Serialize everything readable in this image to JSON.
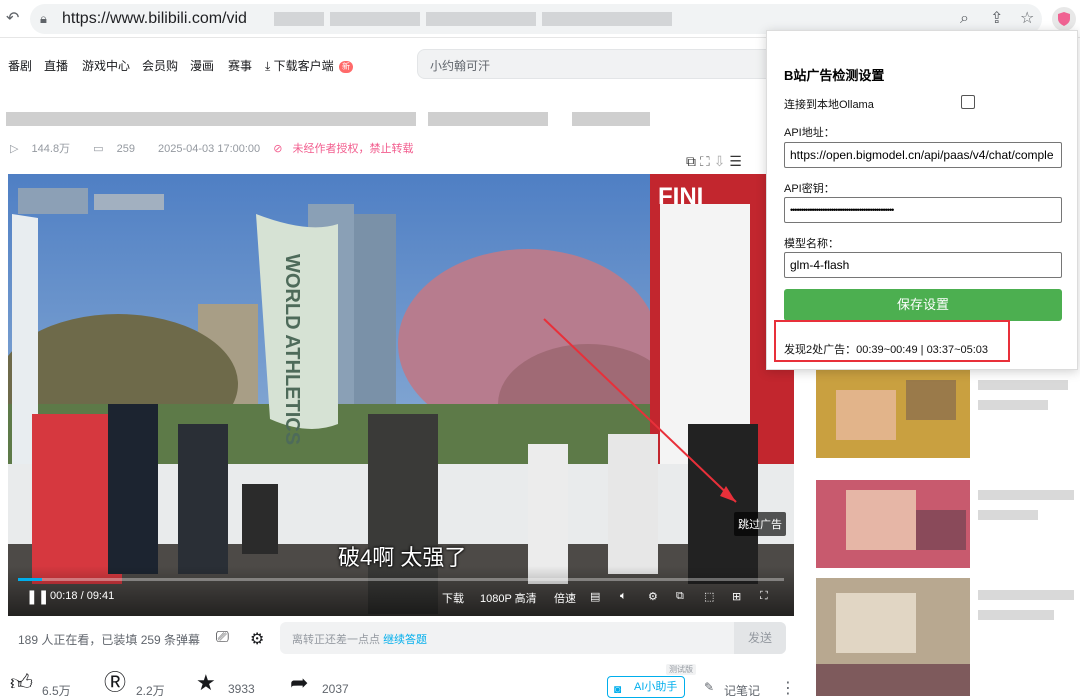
{
  "browser": {
    "url": "https://www.bilibili.com/vid",
    "icons": [
      "back-icon",
      "lock-icon",
      "zoom-icon",
      "share-icon",
      "star-icon",
      "extension-shield-icon"
    ]
  },
  "nav": {
    "items": [
      "番剧",
      "直播",
      "游戏中心",
      "会员购",
      "漫画",
      "赛事",
      "下载客户端"
    ],
    "hot_badge": "新",
    "search_placeholder": "小约翰可汗"
  },
  "video_meta": {
    "views": "144.8万",
    "danmaku": "259",
    "date": "2025-04-03 17:00:00",
    "notice": "未经作者授权，禁止转载"
  },
  "player": {
    "subtitle": "破4啊 太强了",
    "skip_label": "跳过广告",
    "time": "00:18 / 09:41",
    "progress": 0.031,
    "controls": {
      "download": "下载",
      "quality": "1080P 高清",
      "speed": "倍速"
    },
    "scene_text": "WORLD ATHLETICS",
    "banner_text": "FINI"
  },
  "danmaku_bar": {
    "count_text": "189 人正在看，已装填 259 条弹幕",
    "placeholder": "离转正还差一点点",
    "placeholder_link": "继续答题",
    "send_label": "发送"
  },
  "toolbar": {
    "like": "6.5万",
    "coin": "2.2万",
    "fav": "3933",
    "share": "2037",
    "ai_label": "AI小助手",
    "ai_tag": "测试版",
    "note_label": "记笔记"
  },
  "popup": {
    "title": "B站广告检测设置",
    "ollama_label": "连接到本地Ollama",
    "ollama_checked": false,
    "api_url_label": "API地址：",
    "api_url_value": "https://open.bigmodel.cn/api/paas/v4/chat/comple",
    "api_key_label": "API密钥：",
    "api_key_value": "••••••••••••••••••••••••••••••••••••••••••••••••",
    "model_label": "模型名称：",
    "model_value": "glm-4-flash",
    "save_label": "保存设置",
    "result_text": "发现2处广告：00:39~00:49 | 03:37~05:03"
  },
  "colors": {
    "accent": "#00aeec",
    "save_green": "#4caf50",
    "highlight_red": "#e8303a"
  }
}
